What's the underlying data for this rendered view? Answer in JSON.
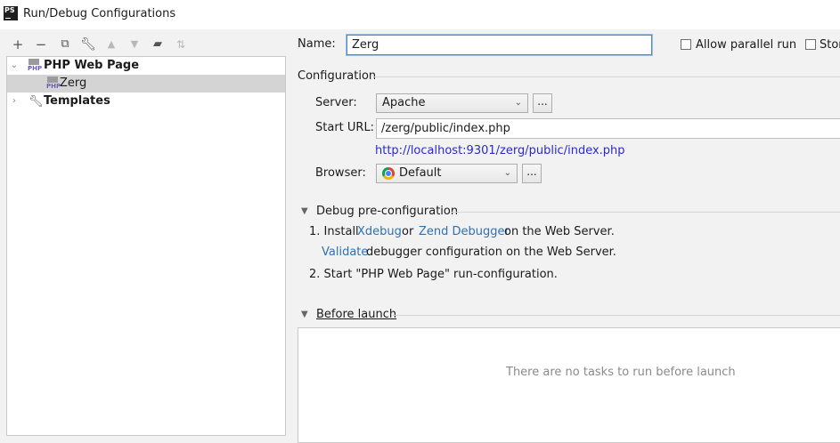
{
  "window": {
    "title": "Run/Debug Configurations",
    "app_icon_text": "PS"
  },
  "toolbar": {
    "icons": [
      "add-icon",
      "remove-icon",
      "copy-icon",
      "wrench-icon",
      "move-up-icon",
      "move-down-icon",
      "folder-icon",
      "sort-icon"
    ]
  },
  "tree": {
    "group": {
      "label": "PHP Web Page",
      "icon_text": "PHP"
    },
    "child": {
      "label": "Zerg",
      "icon_text": "PHP"
    },
    "templates": {
      "label": "Templates"
    }
  },
  "form": {
    "name_label": "Name:",
    "name_value": "Zerg",
    "allow_parallel_label": "Allow parallel run",
    "store_label": "Stor",
    "configuration_label": "Configuration",
    "server_label": "Server:",
    "server_value": "Apache",
    "start_url_label": "Start URL:",
    "start_url_value": "/zerg/public/index.php",
    "resolved_url": "http://localhost:9301/zerg/public/index.php",
    "browser_label": "Browser:",
    "browser_value": "Default",
    "ellipsis": "..."
  },
  "debug": {
    "header": "Debug pre-configuration",
    "step1_prefix": "1. Install",
    "xdebug_link": "Xdebug",
    "or_text": "or",
    "zend_link": "Zend Debugger",
    "step1_suffix": "on the Web Server.",
    "validate_link": "Validate",
    "validate_suffix": "debugger configuration on the Web Server.",
    "step2": "2. Start \"PHP Web Page\" run-configuration."
  },
  "before_launch": {
    "header": "Before launch",
    "empty_text": "There are no tasks to run before launch"
  }
}
